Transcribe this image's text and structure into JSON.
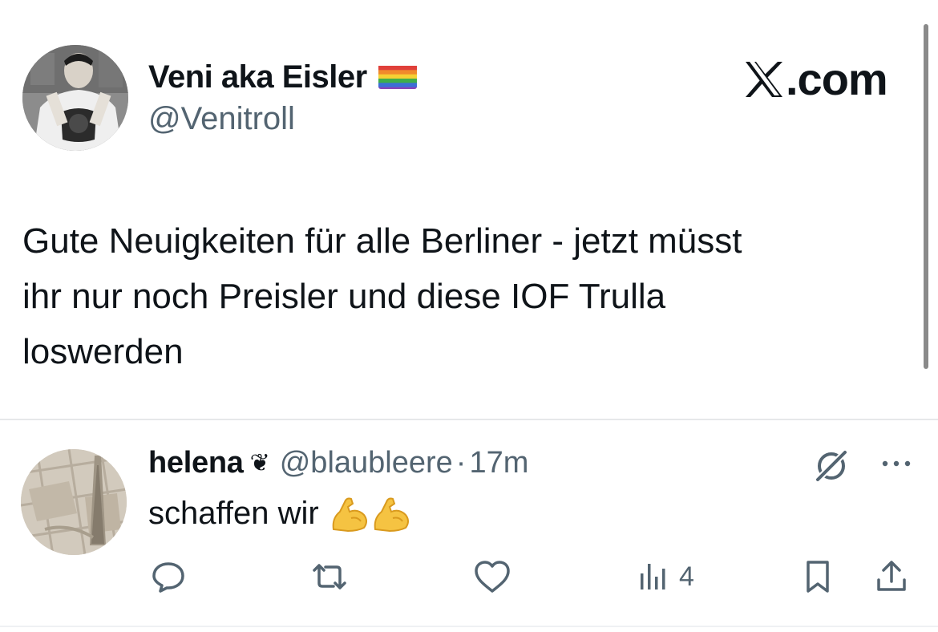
{
  "quoted_tweet": {
    "display_name": "Veni aka Eisler",
    "flag_emoji": "rainbow-flag",
    "handle": "@Venitroll",
    "brand": ".com",
    "brand_icon": "x-logo-icon",
    "text": "Gute Neuigkeiten für alle Berliner - jetzt müsst\nihr nur noch Preisler und diese IOF Trulla\nloswerden"
  },
  "reply": {
    "display_name": "helena",
    "badge": "❦",
    "handle": "@blaubleere",
    "separator": "·",
    "time": "17m",
    "text": "schaffen wir",
    "emojis": [
      "flexed-biceps",
      "flexed-biceps"
    ],
    "actions": {
      "reply_icon": "comment-icon",
      "retweet_icon": "retweet-icon",
      "like_icon": "heart-icon",
      "views_icon": "views-chart-icon",
      "views_count": "4",
      "bookmark_icon": "bookmark-icon",
      "share_icon": "share-icon"
    }
  },
  "colors": {
    "text_primary": "#0f1419",
    "text_secondary": "#536471",
    "divider": "#e6e8ea",
    "emoji_yellow": "#f5c342"
  }
}
